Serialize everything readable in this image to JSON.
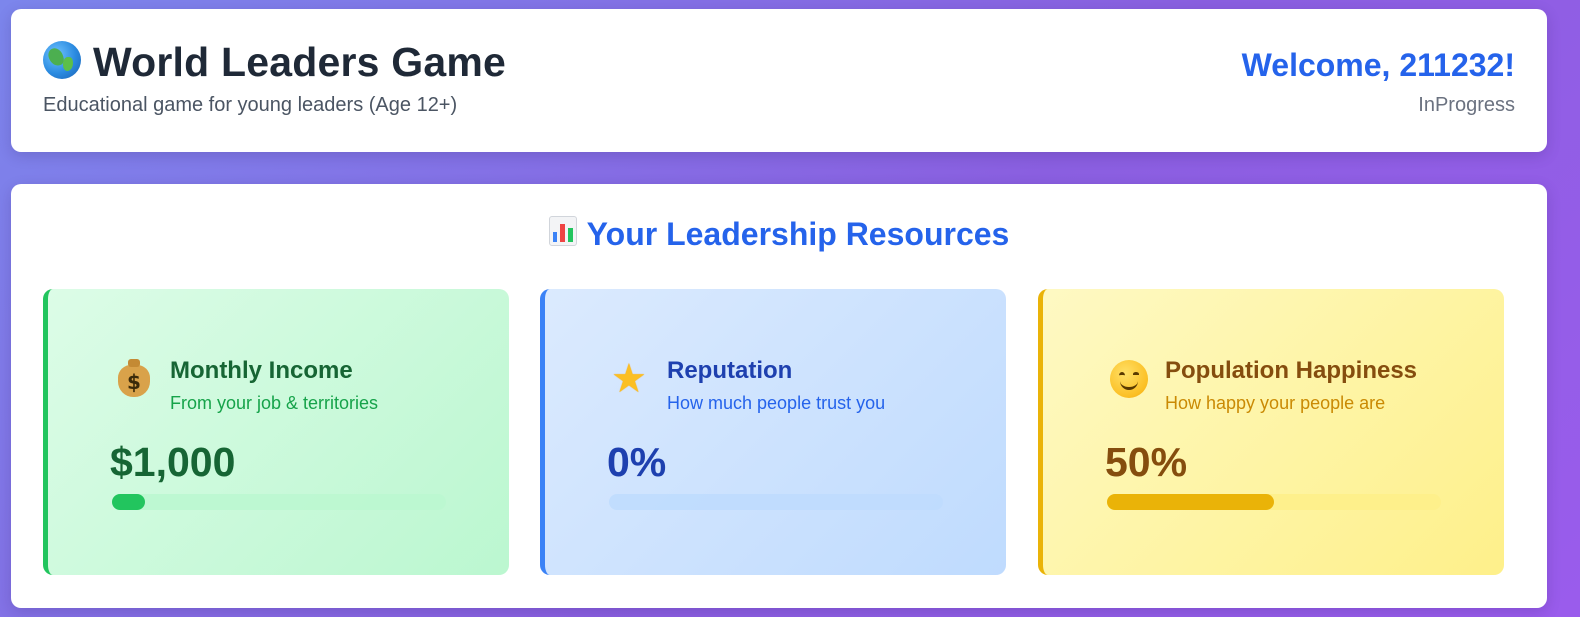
{
  "header": {
    "title": "World Leaders Game",
    "subtitle": "Educational game for young leaders (Age 12+)",
    "welcome": "Welcome, 211232!",
    "status": "InProgress",
    "icon": "globe-icon"
  },
  "resources": {
    "title": "Your Leadership Resources",
    "icon": "bar-chart-icon",
    "cards": [
      {
        "title": "Monthly Income",
        "description": "From your job & territories",
        "value": "$1,000",
        "progress_percent": 10,
        "icon": "money-bag-icon",
        "accent": "#22c55e"
      },
      {
        "title": "Reputation",
        "description": "How much people trust you",
        "value": "0%",
        "progress_percent": 0,
        "icon": "star-icon",
        "accent": "#3b82f6"
      },
      {
        "title": "Population Happiness",
        "description": "How happy your people are",
        "value": "50%",
        "progress_percent": 50,
        "icon": "smiley-icon",
        "accent": "#eab308"
      }
    ]
  }
}
